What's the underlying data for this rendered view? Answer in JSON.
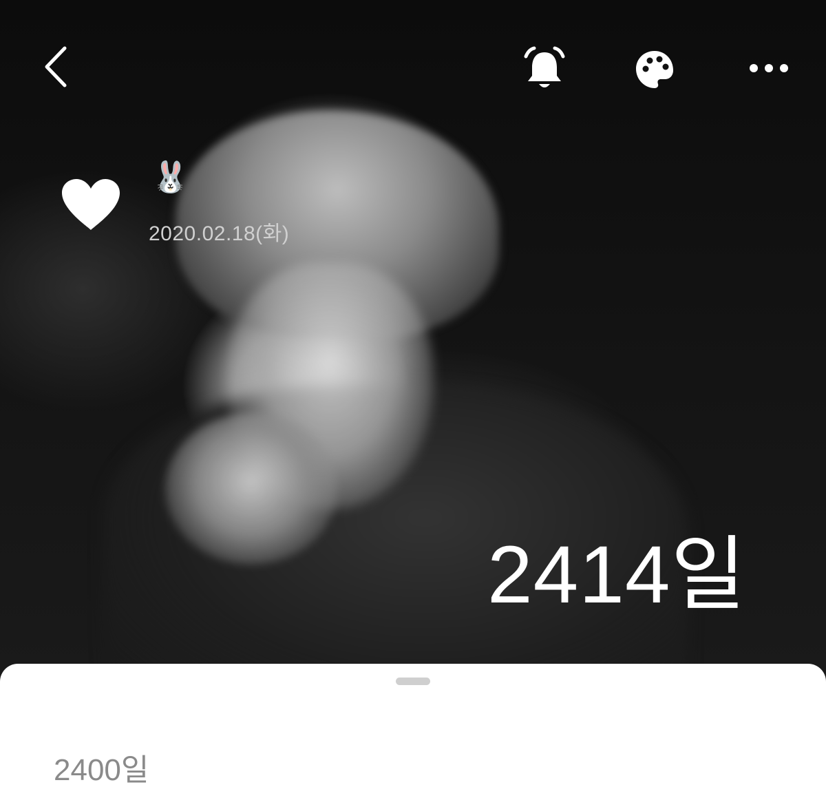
{
  "topbar": {
    "back_icon": "chevron-left-icon",
    "alarm_icon": "bell-icon",
    "theme_icon": "palette-icon",
    "more_icon": "more-horizontal-icon"
  },
  "event": {
    "heart_icon": "heart-icon",
    "emoji": "🐰",
    "date": "2020.02.18(화)",
    "dday": "2414일"
  },
  "sheet": {
    "milestone": "2400일"
  },
  "colors": {
    "overlay_text": "#ffffff",
    "date_text": "#d0d0d0",
    "sheet_bg": "#ffffff",
    "milestone_text": "#8a8a8a"
  }
}
